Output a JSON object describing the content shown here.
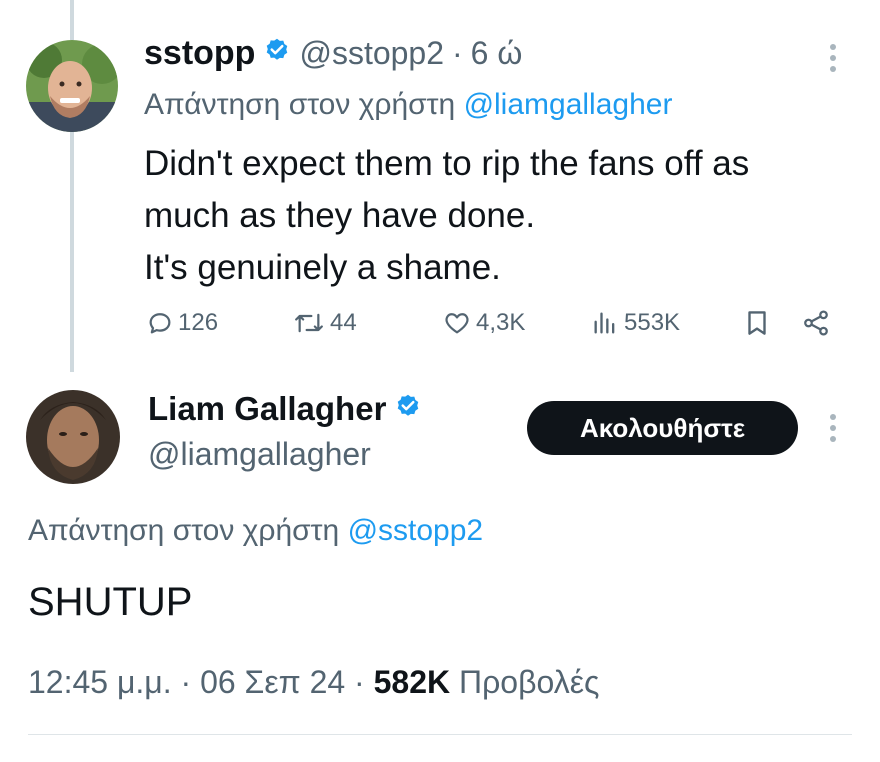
{
  "reply_tweet": {
    "display_name": "sstopp",
    "handle": "@sstopp2",
    "separator": "·",
    "time_ago": "6 ώ",
    "reply_prefix": "Απάντηση στον χρήστη",
    "reply_to": "@liamgallagher",
    "text_lines": [
      "Didn't expect them to rip the fans off as",
      "much as they have done.",
      "It's genuinely a shame."
    ],
    "stats": {
      "replies": "126",
      "reposts": "44",
      "likes": "4,3K",
      "views": "553K"
    },
    "icons": [
      "reply-icon",
      "repost-icon",
      "like-icon",
      "views-icon",
      "bookmark-icon",
      "share-icon",
      "more-icon",
      "verified-badge-icon"
    ]
  },
  "main_tweet": {
    "display_name": "Liam Gallagher",
    "handle": "@liamgallagher",
    "follow_label": "Ακολουθήστε",
    "reply_prefix": "Απάντηση στον χρήστη",
    "reply_to": "@sstopp2",
    "text": "SHUTUP",
    "time": "12:45 μ.μ.",
    "separator": "·",
    "date": "06 Σεπ 24",
    "views_count": "582K",
    "views_label": "Προβολές"
  },
  "colors": {
    "accent": "#1d9bf0",
    "text": "#0f1419",
    "secondary": "#536471",
    "button_bg": "#0f1419",
    "thread_line": "#cfd9de"
  }
}
